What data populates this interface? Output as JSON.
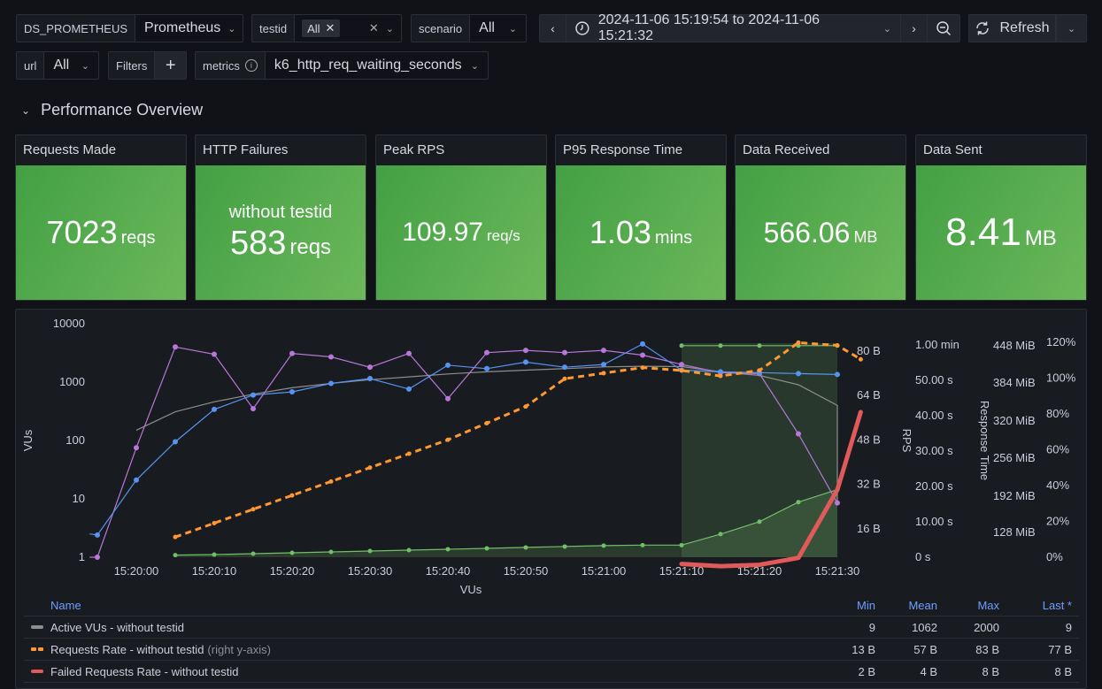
{
  "variables": {
    "datasource": {
      "label": "DS_PROMETHEUS",
      "value": "Prometheus"
    },
    "testid": {
      "label": "testid",
      "chip": "All"
    },
    "scenario": {
      "label": "scenario",
      "value": "All"
    },
    "url": {
      "label": "url",
      "value": "All"
    },
    "filters": {
      "label": "Filters",
      "add": "+"
    },
    "metrics": {
      "label": "metrics",
      "value": "k6_http_req_waiting_seconds"
    }
  },
  "time_picker": {
    "range": "2024-11-06 15:19:54 to 2024-11-06 15:21:32"
  },
  "refresh": {
    "label": "Refresh"
  },
  "row": {
    "title": "Performance Overview"
  },
  "stats": [
    {
      "title": "Requests Made",
      "sub": "",
      "value": "7023",
      "unit": "reqs"
    },
    {
      "title": "HTTP Failures",
      "sub": "without testid",
      "value": "583",
      "unit": "reqs"
    },
    {
      "title": "Peak RPS",
      "sub": "",
      "value": "109.97",
      "unit": "req/s"
    },
    {
      "title": "P95 Response Time",
      "sub": "",
      "value": "1.03",
      "unit": "mins"
    },
    {
      "title": "Data Received",
      "sub": "",
      "value": "566.06",
      "unit": "MB"
    },
    {
      "title": "Data Sent",
      "sub": "",
      "value": "8.41",
      "unit": "MB"
    }
  ],
  "colors": {
    "stat_green": "#53a84c",
    "active_vus": "#8e8e8e",
    "requests_rate": "#ff9830",
    "failed_rate": "#e05a5a",
    "blue": "#5794f2",
    "purple": "#b877d9",
    "green": "#73bf69",
    "header_link": "#6e9fff"
  },
  "chart_data": {
    "type": "line",
    "xlabel": "VUs",
    "x_ticks": [
      "15:20:00",
      "15:20:10",
      "15:20:20",
      "15:20:30",
      "15:20:40",
      "15:20:50",
      "15:21:00",
      "15:21:10",
      "15:21:20",
      "15:21:30"
    ],
    "x_range": [
      "15:19:54",
      "15:21:32"
    ],
    "axes": {
      "left": {
        "label": "VUs",
        "scale": "log",
        "ticks": [
          "1",
          "10",
          "100",
          "1000",
          "10000"
        ],
        "range": [
          1,
          10000
        ]
      },
      "right1": {
        "label": "",
        "ticks": [
          "16 B",
          "32 B",
          "48 B",
          "64 B",
          "80 B"
        ],
        "range": [
          0,
          88
        ]
      },
      "right2": {
        "label": "RPS",
        "ticks": [
          "0 s",
          "10.00 s",
          "20.00 s",
          "30.00 s",
          "40.00 s",
          "50.00 s",
          "1.00 min"
        ],
        "range": [
          0,
          60
        ]
      },
      "right3": {
        "label": "Response Time",
        "ticks": [
          "128 MiB",
          "192 MiB",
          "256 MiB",
          "320 MiB",
          "384 MiB",
          "448 MiB"
        ]
      },
      "right4": {
        "label": "",
        "ticks": [
          "0%",
          "20%",
          "40%",
          "60%",
          "80%",
          "100%",
          "120%"
        ],
        "range": [
          0,
          120
        ]
      }
    },
    "series": [
      {
        "name": "Active VUs - without testid",
        "axis": "left",
        "t": [
          5,
          10,
          15,
          20,
          25,
          30,
          35,
          40,
          45,
          50,
          55,
          60,
          65,
          70,
          75,
          80,
          85,
          90,
          95
        ],
        "values": [
          150,
          310,
          460,
          620,
          800,
          950,
          1100,
          1230,
          1380,
          1500,
          1600,
          1700,
          1820,
          1870,
          1850,
          1500,
          1300,
          900,
          400
        ],
        "style": "solid-thin",
        "trail": [
          [
            95,
            9
          ]
        ]
      },
      {
        "name": "Requests Rate - without testid",
        "axis": "right1",
        "t": [
          10,
          15,
          20,
          25,
          30,
          35,
          40,
          45,
          50,
          55,
          60,
          65,
          70,
          75,
          80,
          85,
          90,
          95,
          98
        ],
        "values": [
          13,
          18,
          23,
          28,
          33,
          38,
          43,
          48,
          54,
          60,
          70,
          72,
          74,
          73,
          71,
          73,
          83,
          82,
          77
        ],
        "style": "dashed"
      },
      {
        "name": "Failed Requests Rate - without testid",
        "axis": "right1",
        "t": [
          75,
          80,
          85,
          90,
          95,
          98
        ],
        "values": [
          3.3,
          2.5,
          3.0,
          5.5,
          30,
          58
        ],
        "style": "thick"
      },
      {
        "name": "blue series",
        "axis": "left",
        "t": [
          -1,
          0,
          5,
          10,
          15,
          20,
          25,
          30,
          35,
          40,
          45,
          50,
          55,
          60,
          65,
          70,
          75,
          80,
          85,
          90,
          95
        ],
        "values": [
          2.5,
          2.4,
          21,
          95,
          340,
          600,
          680,
          950,
          1150,
          760,
          1950,
          1700,
          2200,
          1800,
          2000,
          4500,
          1600,
          1500,
          1450,
          1400,
          1350
        ],
        "style": "line-points"
      },
      {
        "name": "purple series",
        "axis": "left",
        "t": [
          -1,
          0,
          5,
          10,
          15,
          20,
          25,
          30,
          35,
          40,
          45,
          50,
          55,
          60,
          65,
          70,
          75,
          80,
          85,
          90,
          95
        ],
        "values": [
          1,
          1,
          75,
          4000,
          3000,
          350,
          3100,
          2700,
          1800,
          3100,
          520,
          3200,
          3500,
          3200,
          3500,
          2900,
          2000,
          1450,
          1400,
          130,
          8.5
        ],
        "style": "line-points"
      },
      {
        "name": "green area series",
        "axis": "right4",
        "t": [
          10,
          15,
          20,
          25,
          30,
          35,
          40,
          45,
          50,
          55,
          60,
          65,
          70,
          75,
          80,
          85,
          90,
          95
        ],
        "values": [
          1.2,
          1.5,
          2,
          2.5,
          3,
          3.5,
          4,
          4.5,
          5,
          5.5,
          6,
          6.5,
          6.8,
          6.8,
          13,
          20,
          31,
          38
        ],
        "style": "area"
      },
      {
        "name": "green top series",
        "axis": "right4",
        "t": [
          75,
          80,
          85,
          90,
          95
        ],
        "values": [
          119,
          119,
          119,
          119,
          119
        ],
        "style": "line-points"
      }
    ],
    "highlight_region": {
      "from": "15:21:10",
      "to": "15:21:30"
    }
  },
  "legend": {
    "headers": [
      "Name",
      "Min",
      "Mean",
      "Max",
      "Last *"
    ],
    "rows": [
      {
        "name": "Active VUs - without testid",
        "suffix": "",
        "color_key": "active_vus",
        "min": "9",
        "mean": "1062",
        "max": "2000",
        "last": "9"
      },
      {
        "name": "Requests Rate - without testid",
        "suffix": "(right y-axis)",
        "color_key": "requests_rate",
        "min": "13 B",
        "mean": "57 B",
        "max": "83 B",
        "last": "77 B"
      },
      {
        "name": "Failed Requests Rate - without testid",
        "suffix": "",
        "color_key": "failed_rate",
        "min": "2 B",
        "mean": "4 B",
        "max": "8 B",
        "last": "8 B"
      }
    ]
  }
}
